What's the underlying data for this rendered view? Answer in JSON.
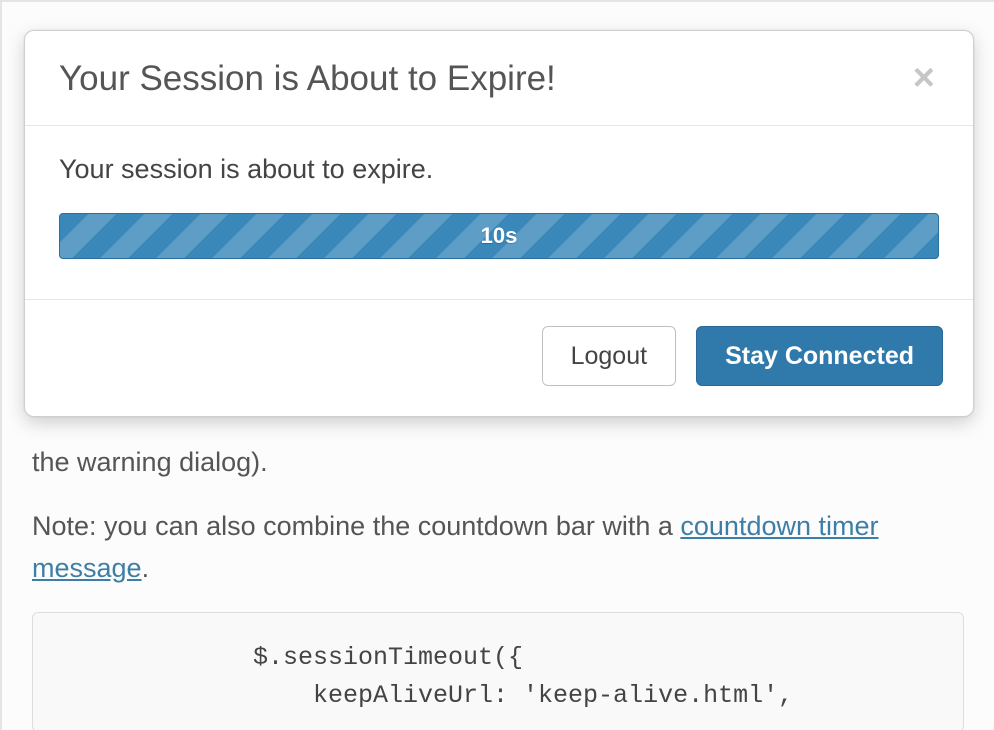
{
  "modal": {
    "title": "Your Session is About to Expire!",
    "close_glyph": "×",
    "body_text": "Your session is about to expire.",
    "countdown_label": "10s"
  },
  "footer": {
    "logout_label": "Logout",
    "stay_label": "Stay Connected"
  },
  "page": {
    "frag1": "the warning dialog).",
    "note_prefix": "Note: you can also combine the countdown bar with a ",
    "note_link": "countdown timer message",
    "note_suffix": ".",
    "code_line1": "$.sessionTimeout({",
    "code_line2": "    keepAliveUrl: 'keep-alive.html',"
  },
  "colors": {
    "primary": "#3079ab",
    "link": "#3d7ea6"
  }
}
